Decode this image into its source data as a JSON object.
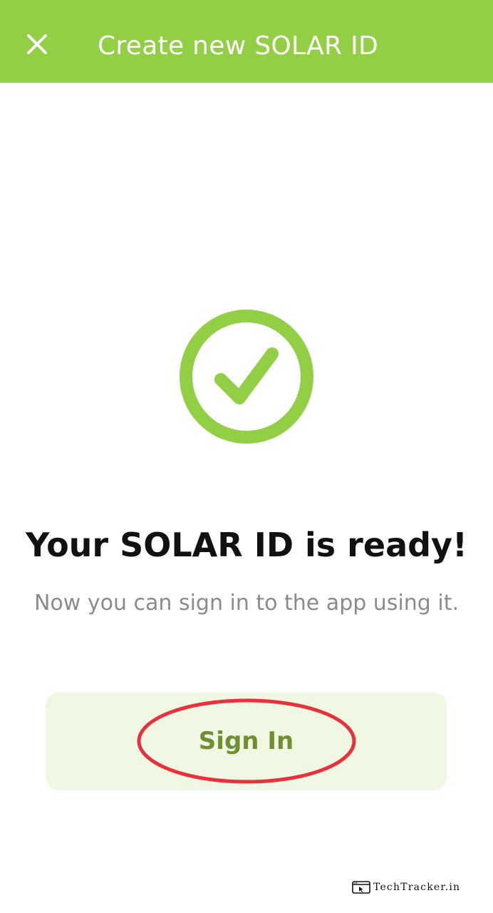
{
  "app_bar": {
    "title": "Create new SOLAR ID",
    "close_icon": "close-icon",
    "background_color": "#93cf45"
  },
  "success": {
    "icon": "check-circle-icon",
    "icon_color": "#93cf45",
    "heading": "Your SOLAR ID is ready!",
    "message": "Now you can sign in to the app using it."
  },
  "signin": {
    "label": "Sign In",
    "background_color": "#f0f7e3",
    "text_color": "#6f8f31"
  },
  "annotation": {
    "shape": "ellipse",
    "color": "#e8313a"
  },
  "watermark": {
    "text": "TechTracker.in",
    "icon": "browser-cursor-icon"
  }
}
